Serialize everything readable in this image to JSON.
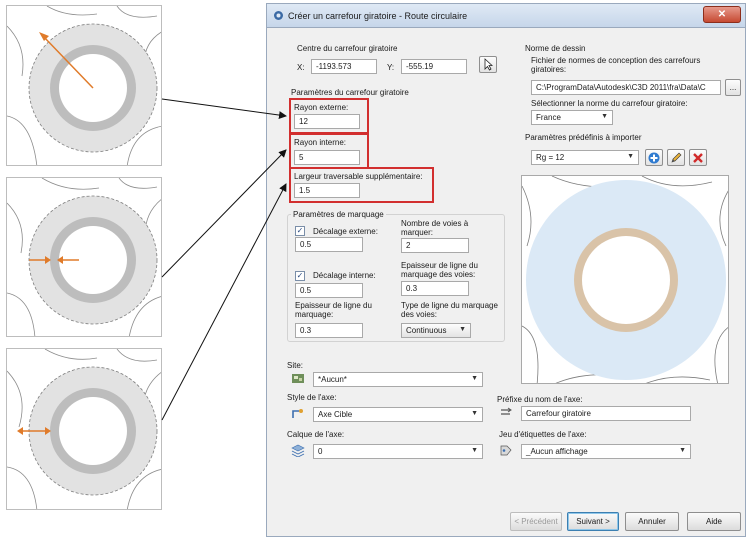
{
  "dialog": {
    "title": "Créer un carrefour giratoire - Route circulaire",
    "close_glyph": "✕"
  },
  "center": {
    "label": "Centre du carrefour giratoire",
    "x_label": "X:",
    "x_value": "-1193.573",
    "y_label": "Y:",
    "y_value": "-555.19"
  },
  "params": {
    "label": "Paramètres du carrefour giratoire",
    "outer_radius_label": "Rayon externe:",
    "outer_radius_value": "12",
    "inner_radius_label": "Rayon interne:",
    "inner_radius_value": "5",
    "extra_width_label": "Largeur traversable supplémentaire:",
    "extra_width_value": "1.5"
  },
  "marking": {
    "label": "Paramètres de marquage",
    "outer_offset_label": "Décalage externe:",
    "outer_offset_checked": true,
    "outer_offset_value": "0.5",
    "lanes_label": "Nombre de voies à marquer:",
    "lanes_value": "2",
    "inner_offset_label": "Décalage interne:",
    "inner_offset_checked": true,
    "inner_offset_value": "0.5",
    "lane_line_thickness_label": "Epaisseur de ligne du marquage des voies:",
    "lane_line_thickness_value": "0.3",
    "marking_line_thickness_label": "Epaisseur de ligne du marquage:",
    "marking_line_thickness_value": "0.3",
    "line_type_label": "Type de ligne du marquage des voies:",
    "line_type_value": "Continuous"
  },
  "design": {
    "label": "Norme de dessin",
    "file_label": "Fichier de normes de conception des carrefours giratoires:",
    "file_path": "C:\\ProgramData\\Autodesk\\C3D 2011\\fra\\Data\\C",
    "browse_label": "...",
    "standard_label": "Sélectionner la norme du carrefour giratoire:",
    "standard_value": "France"
  },
  "presets": {
    "label": "Paramètres prédéfinis à importer",
    "value": "Rg = 12"
  },
  "site": {
    "label": "Site:",
    "value": "*Aucun*"
  },
  "axis_style": {
    "label": "Style de l'axe:",
    "value": "Axe Cible"
  },
  "axis_layer": {
    "label": "Calque de l'axe:",
    "value": "0"
  },
  "axis_prefix": {
    "label": "Préfixe du nom de l'axe:",
    "value": "Carrefour giratoire"
  },
  "label_set": {
    "label": "Jeu d'étiquettes de l'axe:",
    "value": "_Aucun affichage"
  },
  "footer": {
    "prev_label": "< Précédent",
    "next_label": "Suivant >",
    "cancel_label": "Annuler",
    "help_label": "Aide"
  },
  "colors": {
    "highlight_red": "#d22f2f",
    "annotation_orange": "#e07b2a",
    "roundabout_grey": "#c8c8c8",
    "preview_blue": "#dbe9f6",
    "preview_ring": "#d9c3a8"
  },
  "icons": {
    "pick_point": "cursor-pick-icon",
    "add": "plus-icon",
    "edit": "pencil-icon",
    "delete": "red-x-icon",
    "site": "site-icon",
    "style": "style-icon",
    "layer": "layer-stack-icon",
    "prefix": "prefix-icon",
    "label_set": "label-set-icon"
  }
}
